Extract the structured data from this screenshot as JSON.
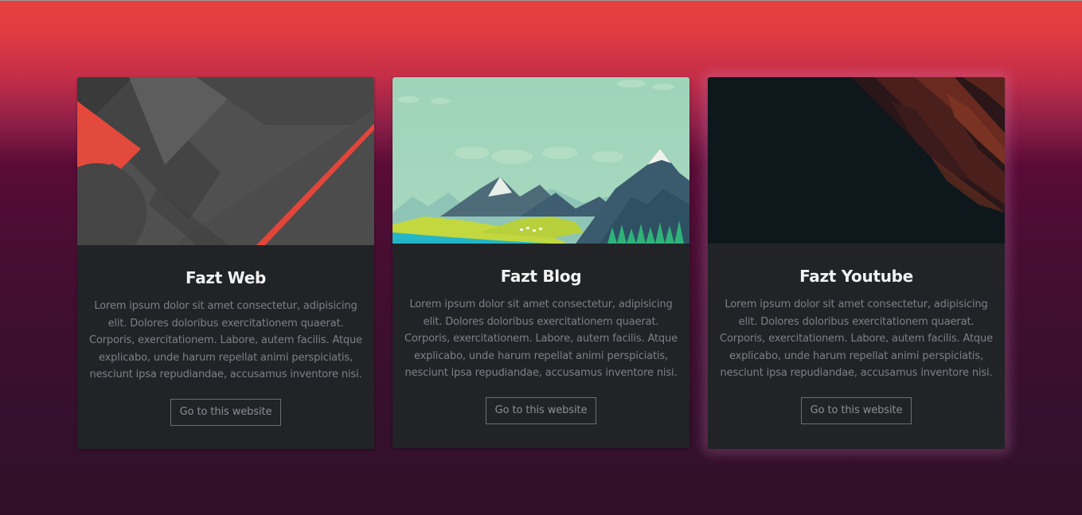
{
  "cards": [
    {
      "title": "Fazt Web",
      "text": "Lorem ipsum dolor sit amet consectetur, adipisicing elit. Dolores doloribus exercitationem quaerat. Corporis, exercitationem. Labore, autem facilis. Atque explicabo, unde harum repellat animi perspiciatis, nesciunt ipsa repudiandae, accusamus inventore nisi.",
      "button_label": "Go to this website"
    },
    {
      "title": "Fazt Blog",
      "text": "Lorem ipsum dolor sit amet consectetur, adipisicing elit. Dolores doloribus exercitationem quaerat. Corporis, exercitationem. Labore, autem facilis. Atque explicabo, unde harum repellat animi perspiciatis, nesciunt ipsa repudiandae, accusamus inventore nisi.",
      "button_label": "Go to this website"
    },
    {
      "title": "Fazt Youtube",
      "text": "Lorem ipsum dolor sit amet consectetur, adipisicing elit. Dolores doloribus exercitationem quaerat. Corporis, exercitationem. Labore, autem facilis. Atque explicabo, unde harum repellat animi perspiciatis, nesciunt ipsa repudiandae, accusamus inventore nisi.",
      "button_label": "Go to this website"
    }
  ],
  "colors": {
    "background_top": "#e8403f",
    "background_bottom": "#311027",
    "card_background": "#212327",
    "title": "#f2f2f2",
    "text": "#7d8086",
    "button_border": "#6a6d72"
  }
}
